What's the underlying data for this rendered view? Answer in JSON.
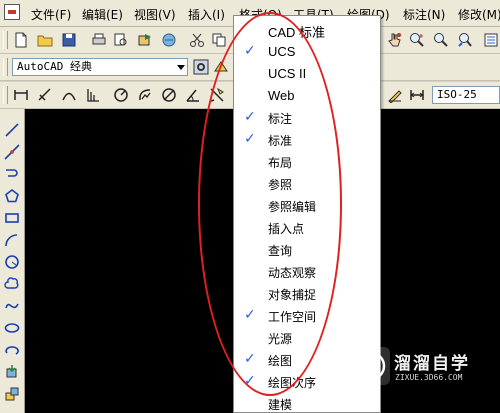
{
  "menubar": {
    "items": [
      "文件(F)",
      "编辑(E)",
      "视图(V)",
      "插入(I)",
      "格式(O)",
      "工具(T)",
      "绘图(D)",
      "标注(N)",
      "修改(M)"
    ]
  },
  "workspace_combo": {
    "value": "AutoCAD 经典"
  },
  "dimstyle_combo": {
    "value": "ISO-25"
  },
  "context_menu": {
    "items": [
      {
        "label": "CAD 标准",
        "checked": false
      },
      {
        "label": "UCS",
        "checked": true
      },
      {
        "label": "UCS II",
        "checked": false
      },
      {
        "label": "Web",
        "checked": false
      },
      {
        "label": "标注",
        "checked": true
      },
      {
        "label": "标准",
        "checked": true
      },
      {
        "label": "布局",
        "checked": false
      },
      {
        "label": "参照",
        "checked": false
      },
      {
        "label": "参照编辑",
        "checked": false
      },
      {
        "label": "插入点",
        "checked": false
      },
      {
        "label": "查询",
        "checked": false
      },
      {
        "label": "动态观察",
        "checked": false
      },
      {
        "label": "对象捕捉",
        "checked": false
      },
      {
        "label": "工作空间",
        "checked": true
      },
      {
        "label": "光源",
        "checked": false
      },
      {
        "label": "绘图",
        "checked": true
      },
      {
        "label": "绘图次序",
        "checked": true
      },
      {
        "label": "建模",
        "checked": false
      }
    ]
  },
  "watermark": {
    "title": "溜溜自学",
    "url": "ZIXUE.3D66.COM"
  },
  "colors": {
    "accent_check": "#2a5bd7",
    "annotation_red": "#e02020",
    "canvas": "#000000"
  }
}
